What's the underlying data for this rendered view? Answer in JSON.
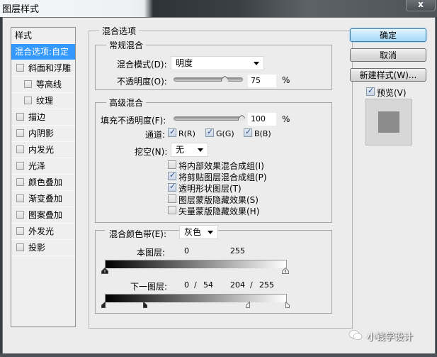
{
  "window": {
    "title": "图层样式",
    "close_label": "x"
  },
  "sidebar": {
    "header": "样式",
    "items": [
      {
        "label": "混合选项:自定",
        "active": true,
        "checkbox": false
      },
      {
        "label": "斜面和浮雕",
        "checked": false,
        "indent": 0
      },
      {
        "label": "等高线",
        "checked": false,
        "indent": 1
      },
      {
        "label": "纹理",
        "checked": false,
        "indent": 1
      },
      {
        "label": "描边",
        "checked": false,
        "indent": 0
      },
      {
        "label": "内阴影",
        "checked": false,
        "indent": 0
      },
      {
        "label": "内发光",
        "checked": false,
        "indent": 0
      },
      {
        "label": "光泽",
        "checked": false,
        "indent": 0
      },
      {
        "label": "颜色叠加",
        "checked": false,
        "indent": 0
      },
      {
        "label": "渐变叠加",
        "checked": false,
        "indent": 0
      },
      {
        "label": "图案叠加",
        "checked": false,
        "indent": 0
      },
      {
        "label": "外发光",
        "checked": false,
        "indent": 0
      },
      {
        "label": "投影",
        "checked": false,
        "indent": 0
      }
    ]
  },
  "blend_options": {
    "title": "混合选项",
    "general": {
      "title": "常规混合",
      "mode_label": "混合模式(D):",
      "mode_value": "明度",
      "opacity_label": "不透明度(O):",
      "opacity_value": "75",
      "opacity_fraction": 0.75,
      "percent": "%"
    },
    "advanced": {
      "title": "高级混合",
      "fill_label": "填充不透明度(F):",
      "fill_value": "100",
      "fill_fraction": 1.0,
      "percent": "%",
      "channels_label": "通道:",
      "channels": [
        {
          "label": "R(R)",
          "checked": true
        },
        {
          "label": "G(G)",
          "checked": true
        },
        {
          "label": "B(B)",
          "checked": true
        }
      ],
      "knockout_label": "挖空(N):",
      "knockout_value": "无",
      "options": [
        {
          "label": "将内部效果混合成组(I)",
          "checked": false
        },
        {
          "label": "将剪贴图层混合成组(P)",
          "checked": true
        },
        {
          "label": "透明形状图层(T)",
          "checked": true
        },
        {
          "label": "图层蒙版隐藏效果(S)",
          "checked": false
        },
        {
          "label": "矢量蒙版隐藏效果(H)",
          "checked": false
        }
      ]
    },
    "blend_if": {
      "label": "混合颜色带(E):",
      "value": "灰色",
      "this_layer_label": "本图层:",
      "this_layer_low": "0",
      "this_layer_high": "255",
      "underlying_label": "下一图层:",
      "underlying_low": "0",
      "underlying_low2": "54",
      "underlying_high": "204",
      "underlying_high2": "255",
      "slash": "/"
    }
  },
  "buttons": {
    "ok": "确定",
    "cancel": "取消",
    "new_style": "新建样式(W)...",
    "preview_label": "预览(V)",
    "preview_checked": true
  },
  "watermark": "小钱学设计"
}
